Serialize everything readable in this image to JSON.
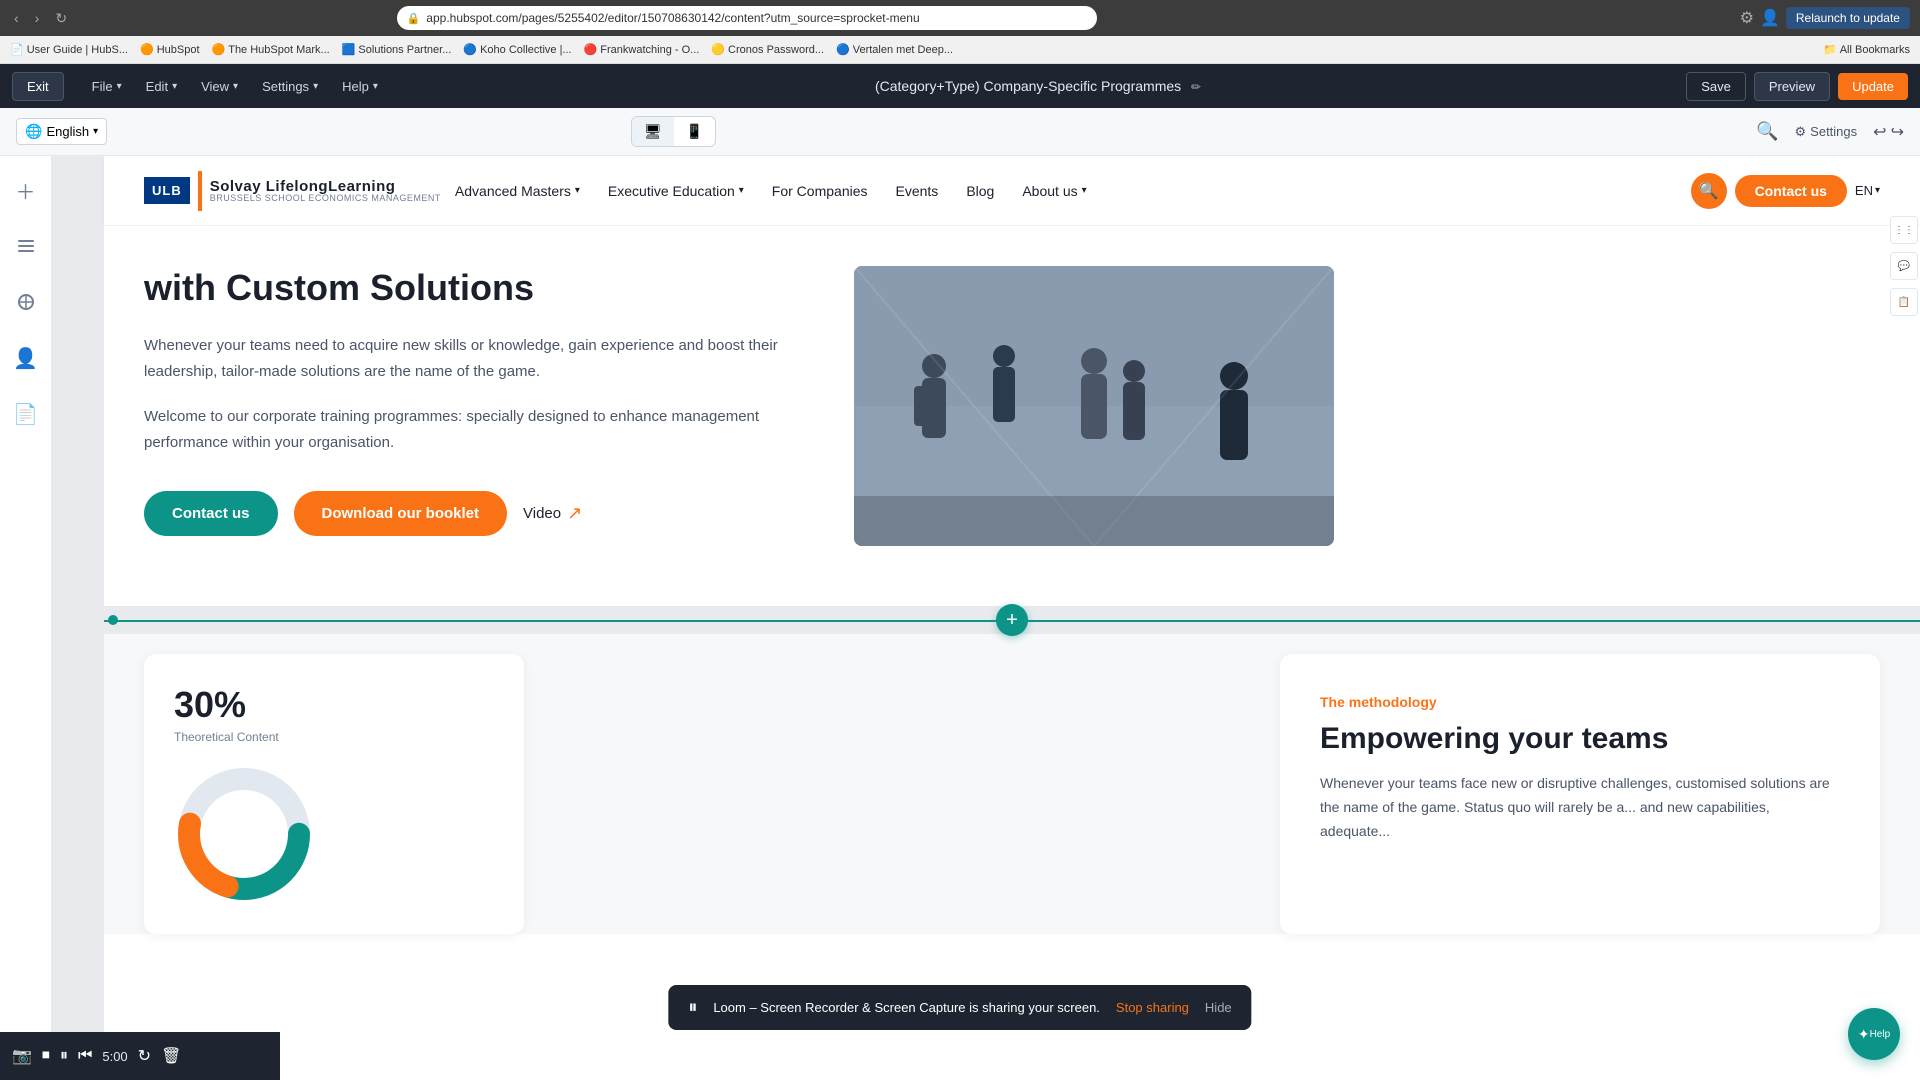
{
  "browser": {
    "url": "app.hubspot.com/pages/5255402/editor/150708630142/content?utm_source=sprocket-menu",
    "relaunch_label": "Relaunch to update",
    "bookmarks": [
      {
        "label": "User Guide | HubS..."
      },
      {
        "label": "HubSpot"
      },
      {
        "label": "The HubSpot Mark..."
      },
      {
        "label": "Solutions Partner..."
      },
      {
        "label": "Koho Collective |..."
      },
      {
        "label": "Frankwatching - O..."
      },
      {
        "label": "Cronos Password..."
      },
      {
        "label": "Vertalen met Deep..."
      },
      {
        "label": "All Bookmarks"
      }
    ]
  },
  "hubspot_toolbar": {
    "exit_label": "Exit",
    "file_label": "File",
    "edit_label": "Edit",
    "view_label": "View",
    "settings_label": "Settings",
    "help_label": "Help",
    "title": "(Category+Type) Company-Specific Programmes",
    "save_label": "Save",
    "preview_label": "Preview",
    "update_label": "Update"
  },
  "toolbar_row2": {
    "language": "English",
    "desktop_icon": "🖥",
    "mobile_icon": "📱",
    "settings_label": "Settings"
  },
  "site": {
    "logo": {
      "ulb": "ULB",
      "solvay": "Solvay",
      "solvay_full": "Solvay LifelongLearning",
      "sub": "BRUSSELS SCHOOL ECONOMICS MANAGEMENT"
    },
    "nav": {
      "links": [
        {
          "label": "Advanced Masters",
          "has_dropdown": true
        },
        {
          "label": "Executive Education",
          "has_dropdown": true
        },
        {
          "label": "For Companies",
          "has_dropdown": false
        },
        {
          "label": "Events",
          "has_dropdown": false
        },
        {
          "label": "Blog",
          "has_dropdown": false
        },
        {
          "label": "About us",
          "has_dropdown": true
        }
      ],
      "contact_label": "Contact us",
      "lang": "EN"
    }
  },
  "hero": {
    "title": "with Custom Solutions",
    "desc1": "Whenever your teams need to acquire new skills or knowledge, gain experience and boost their leadership, tailor-made solutions are the name of the game.",
    "desc2": "Welcome to our corporate training programmes: specially designed to enhance management performance within your organisation.",
    "btn_contact": "Contact us",
    "btn_booklet": "Download our booklet",
    "btn_video": "Video"
  },
  "methodology": {
    "tag": "The methodology",
    "title": "Empowering your teams",
    "desc": "Whenever your teams face new or disruptive challenges, customised solutions are the name of the game. Status quo will rarely be a... and new capabilities, adequate..."
  },
  "chart": {
    "pct": "30%",
    "label": "Theoretical Content"
  },
  "loom": {
    "message": "Loom – Screen Recorder & Screen Capture is sharing your screen.",
    "stop_label": "Stop sharing",
    "hide_label": "Hide"
  },
  "recording": {
    "time": "5:00"
  },
  "help_label": "Help",
  "add_section_tooltip": "+"
}
